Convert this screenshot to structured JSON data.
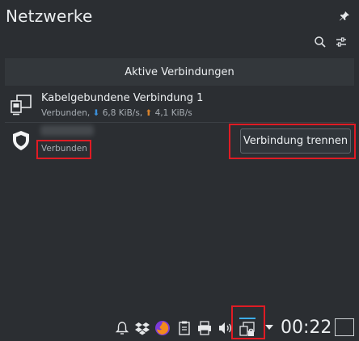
{
  "window": {
    "title": "Netzwerke"
  },
  "header": {
    "active_connections_label": "Aktive Verbindungen"
  },
  "connections": [
    {
      "name": "Kabelgebundene Verbindung 1",
      "status": "Verbunden,",
      "download": "6,8 KiB/s",
      "upload": "4,1 KiB/s"
    },
    {
      "name": "",
      "status": "Verbunden",
      "action_label": "Verbindung trennen"
    }
  ],
  "taskbar": {
    "clock": "00:22",
    "icons": [
      "notifications-icon",
      "dropbox-icon",
      "firefox-icon",
      "clipboard-icon",
      "printer-icon",
      "volume-icon",
      "network-icon",
      "expand-tray-icon"
    ]
  },
  "colors": {
    "background": "#2b2e32",
    "highlight": "#e01b24",
    "download_arrow": "#3b8fd9",
    "upload_arrow": "#d9822b",
    "accent": "#3daee9"
  }
}
